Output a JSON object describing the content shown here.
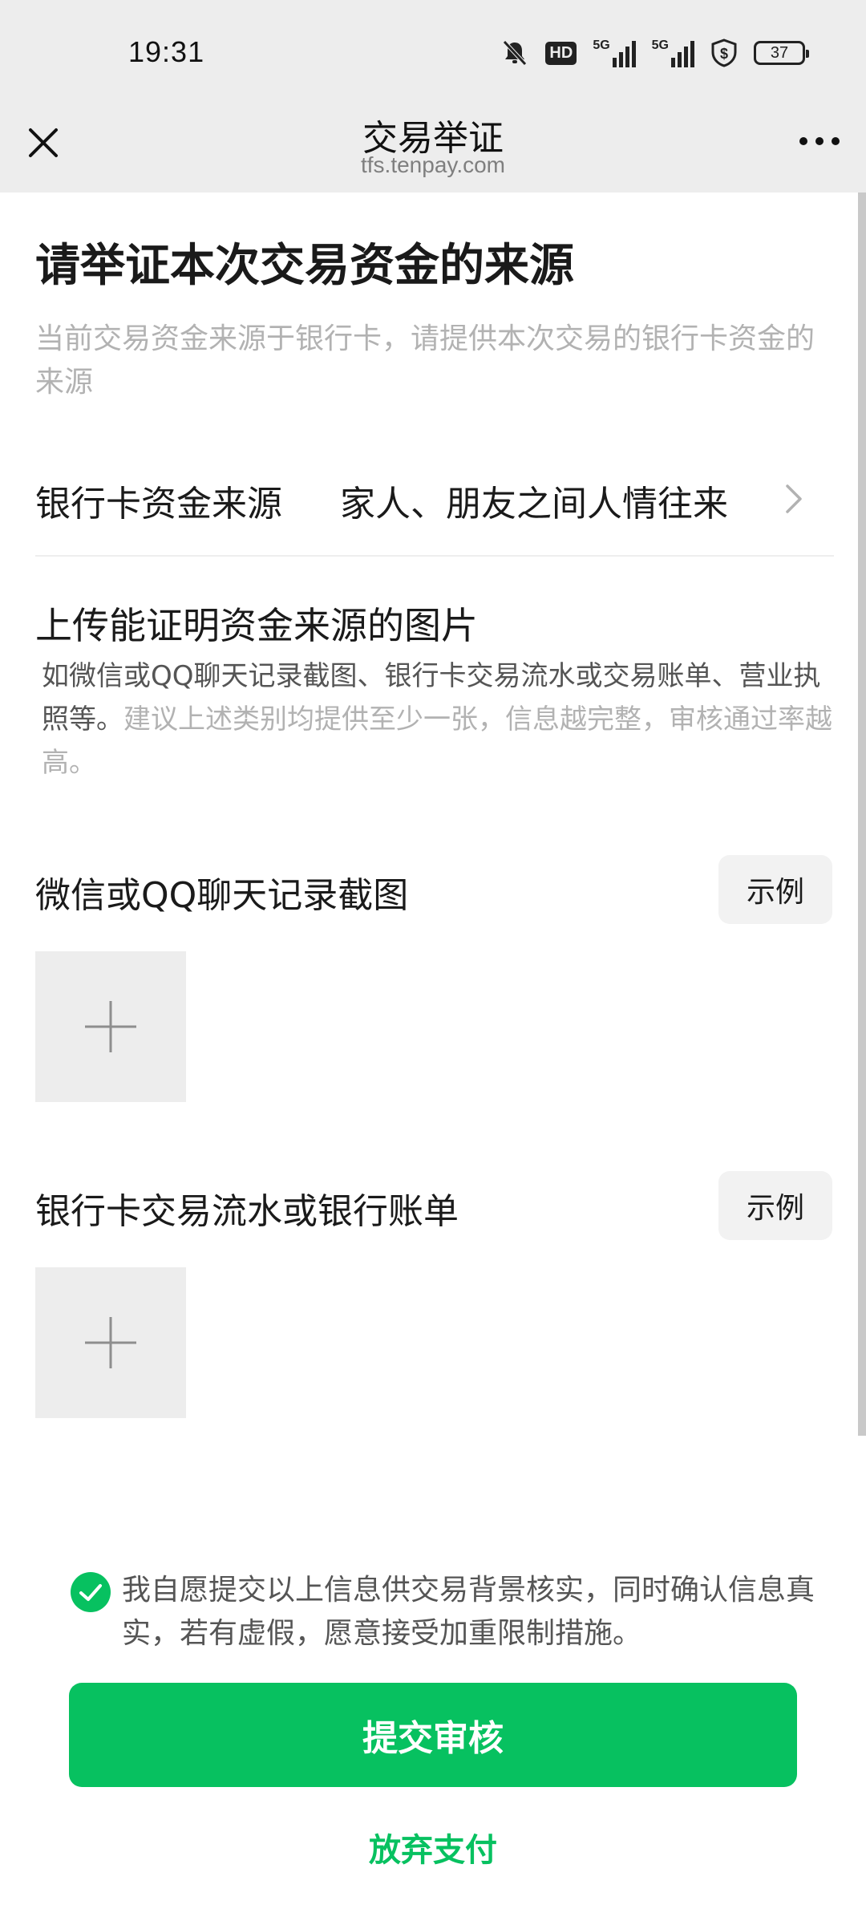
{
  "status_bar": {
    "time": "19:31",
    "network_label": "5G",
    "hd_label": "HD",
    "battery": "37"
  },
  "nav": {
    "title": "交易举证",
    "subtitle": "tfs.tenpay.com"
  },
  "page": {
    "title": "请举证本次交易资金的来源",
    "description": "当前交易资金来源于银行卡，请提供本次交易的银行卡资金的来源"
  },
  "source": {
    "label": "银行卡资金来源",
    "value": "家人、朋友之间人情往来"
  },
  "upload": {
    "title": "上传能证明资金来源的图片",
    "desc_dark": "如微信或QQ聊天记录截图、银行卡交易流水或交易账单、营业执照等。",
    "desc_light": "建议上述类别均提供至少一张，信息越完整，审核通过率越高。"
  },
  "groups": [
    {
      "title": "微信或QQ聊天记录截图",
      "example_label": "示例"
    },
    {
      "title": "银行卡交易流水或银行账单",
      "example_label": "示例"
    }
  ],
  "agreement": {
    "checked": true,
    "text": "我自愿提交以上信息供交易背景核实，同时确认信息真实，若有虚假，愿意接受加重限制措施。"
  },
  "actions": {
    "submit_label": "提交审核",
    "abandon_label": "放弃支付"
  },
  "colors": {
    "brand_green": "#07c160",
    "header_bg": "#ededed",
    "muted_text": "#b2b2b2"
  }
}
